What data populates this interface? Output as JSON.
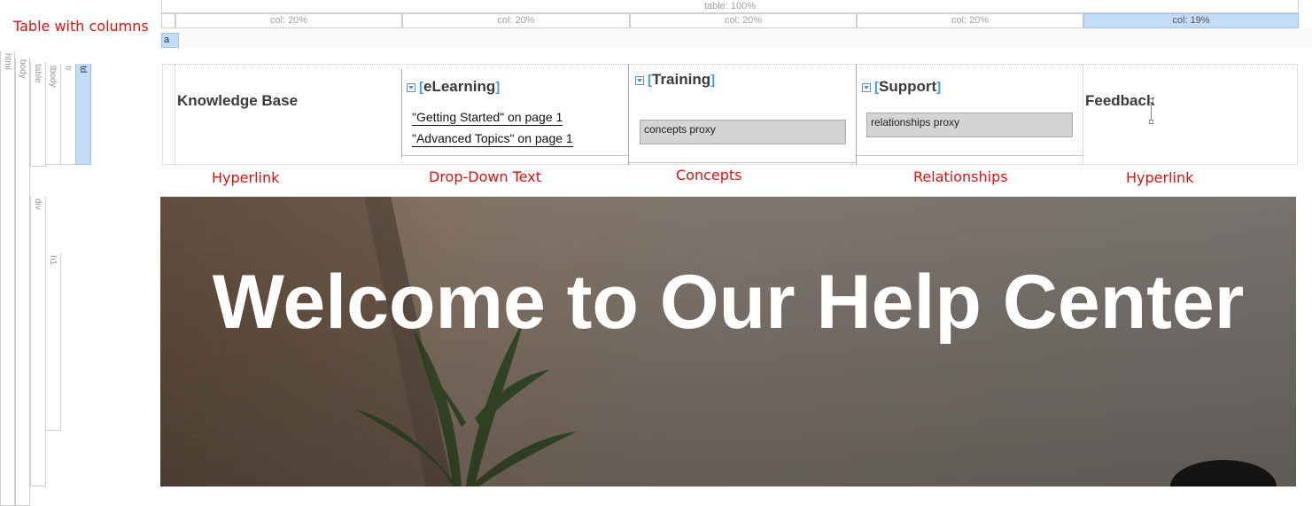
{
  "annotations": {
    "table_with_columns": "Table with columns",
    "hyperlink_1": "Hyperlink",
    "drop_down_text": "Drop-Down Text",
    "concepts": "Concepts",
    "relationships": "Relationships",
    "hyperlink_2": "Hyperlink"
  },
  "ruler": {
    "table": "table: 100%",
    "cols": [
      "col: 20%",
      "col: 20%",
      "col: 20%",
      "col: 20%",
      "col: 19%"
    ],
    "anchor_tag": "a"
  },
  "structure_tags": [
    "html",
    "body",
    "table",
    "tbody",
    "tr",
    "td",
    "div",
    "h1"
  ],
  "cells": {
    "knowledge_base": "Knowledge Base",
    "elearning": {
      "title": "eLearning",
      "links": [
        "\"Getting Started\" on page 1",
        "\"Advanced Topics\" on page 1"
      ]
    },
    "training": {
      "title": "Training",
      "proxy": "concepts proxy"
    },
    "support": {
      "title": "Support",
      "proxy": "relationships proxy"
    },
    "feedback": "Feedback"
  },
  "hero": {
    "title": "Welcome to Our Help Center"
  },
  "colors": {
    "annotation": "#e01010",
    "selection": "#c3dcf7",
    "marker": "#3aa0d8"
  }
}
